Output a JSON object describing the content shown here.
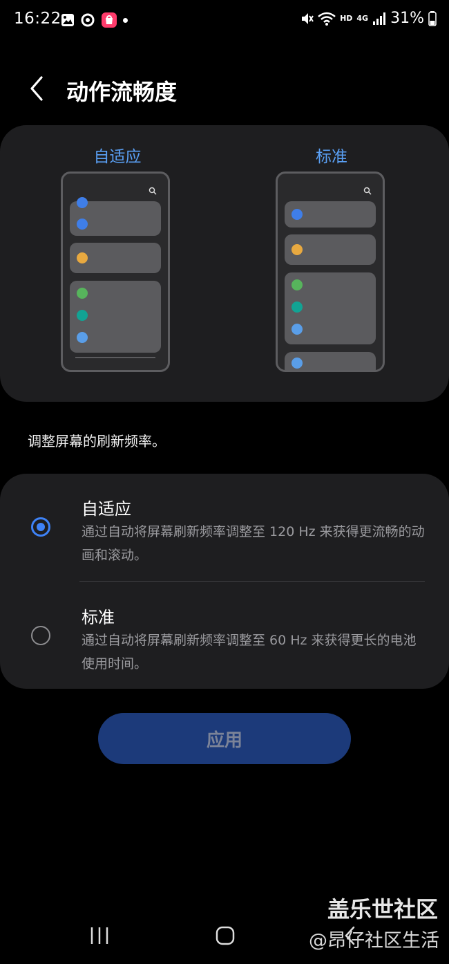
{
  "status_bar": {
    "time": "16:22",
    "network_hd": "HD",
    "network_4g": "4G",
    "battery": "31%",
    "icons_left": [
      "gallery-icon",
      "sync-icon",
      "shop-icon",
      "notification-dot"
    ],
    "icons_right": [
      "mute-icon",
      "wifi-icon",
      "signal-icon",
      "battery-icon"
    ]
  },
  "header": {
    "back_icon": "chevron-left-icon",
    "title": "动作流畅度"
  },
  "preview": {
    "adaptive_label": "自适应",
    "standard_label": "标准"
  },
  "caption": "调整屏幕的刷新频率。",
  "options": [
    {
      "title": "自适应",
      "description": "通过自动将屏幕刷新频率调整至 120 Hz 来获得更流畅的动画和滚动。",
      "selected": true
    },
    {
      "title": "标准",
      "description": "通过自动将屏幕刷新频率调整至 60 Hz 来获得更长的电池使用时间。",
      "selected": false
    }
  ],
  "apply_button": "应用",
  "nav": {
    "recent_icon": "recents-icon",
    "home_icon": "home-icon",
    "back_icon": "back-icon"
  },
  "watermark": {
    "line1": "盖乐世社区",
    "line2": "@昂仔社区生活"
  },
  "colors": {
    "accent": "#3e82f6",
    "label_blue": "#5aa0f5",
    "card_bg": "#1e1e20",
    "apply_bg": "#1c3a7a"
  }
}
